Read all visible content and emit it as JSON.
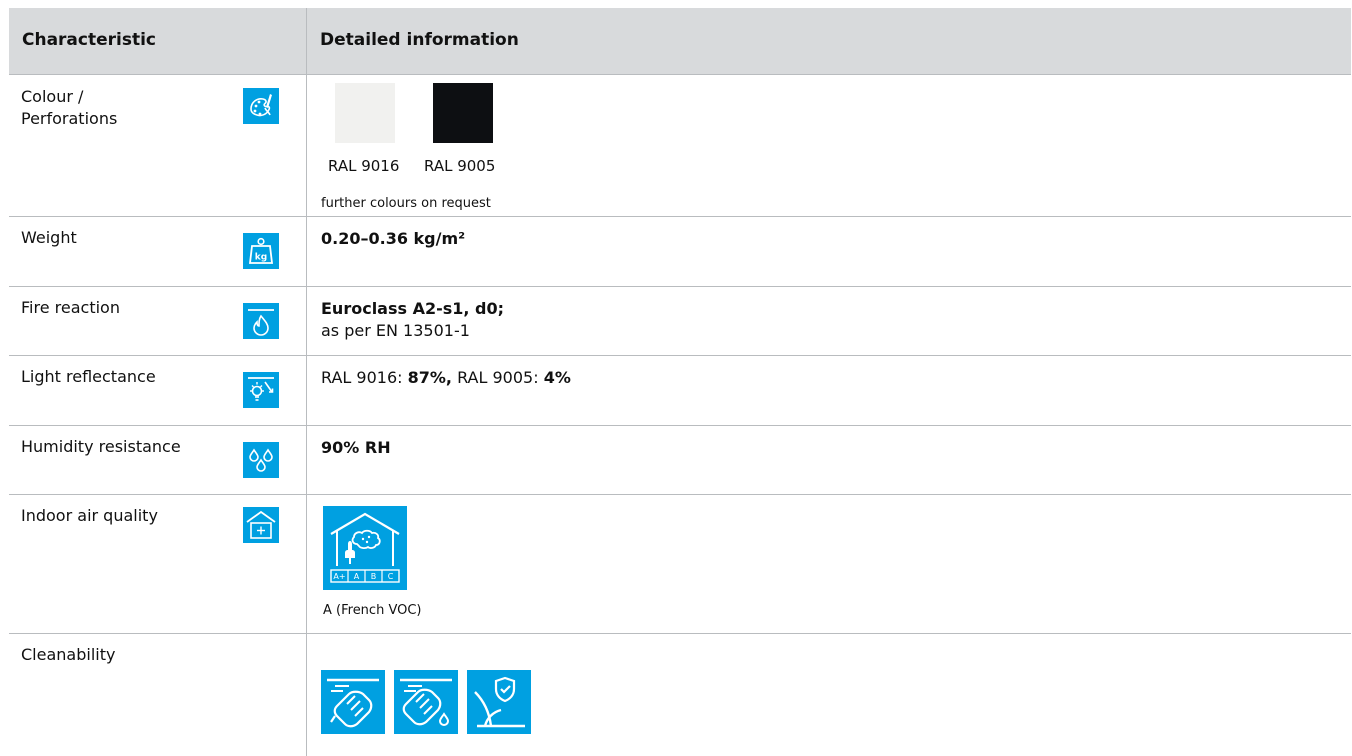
{
  "header": {
    "characteristic": "Characteristic",
    "detailed": "Detailed information"
  },
  "rows": [
    {
      "label_line1": "Colour /",
      "label_line2": "Perforations",
      "icon": "palette-brush-icon",
      "swatches": [
        {
          "label": "RAL 9016",
          "color": "#f1f1ef"
        },
        {
          "label": "RAL 9005",
          "color": "#0d0f12"
        }
      ],
      "note": "further colours on request"
    },
    {
      "label": "Weight",
      "icon": "weight-kg-icon",
      "icon_text": "kg",
      "value": "0.20–0.36 kg/m²"
    },
    {
      "label": "Fire reaction",
      "icon": "flame-icon",
      "value_bold": "Euroclass A2-s1, d0;",
      "value_normal": "as per EN 13501-1"
    },
    {
      "label": "Light reflectance",
      "icon": "light-reflect-icon",
      "p1": "RAL 9016: ",
      "b1": "87%,",
      "p2": " RAL 9005: ",
      "b2": "4%"
    },
    {
      "label": "Humidity resistance",
      "icon": "droplets-icon",
      "value": "90% RH"
    },
    {
      "label": "Indoor air quality",
      "icon": "indoor-air-icon",
      "badge_icon": "voc-label-icon",
      "badge_classes": [
        "A+",
        "A",
        "B",
        "C"
      ],
      "badge_caption": "A (French VOC)"
    },
    {
      "label": "Cleanability",
      "icons": [
        "wipe-dry-icon",
        "wipe-wet-icon",
        "scratch-resistant-icon"
      ]
    }
  ],
  "colors": {
    "accent": "#00a0e1",
    "header_bg": "#d8dadc",
    "border": "#b9bcbf"
  }
}
